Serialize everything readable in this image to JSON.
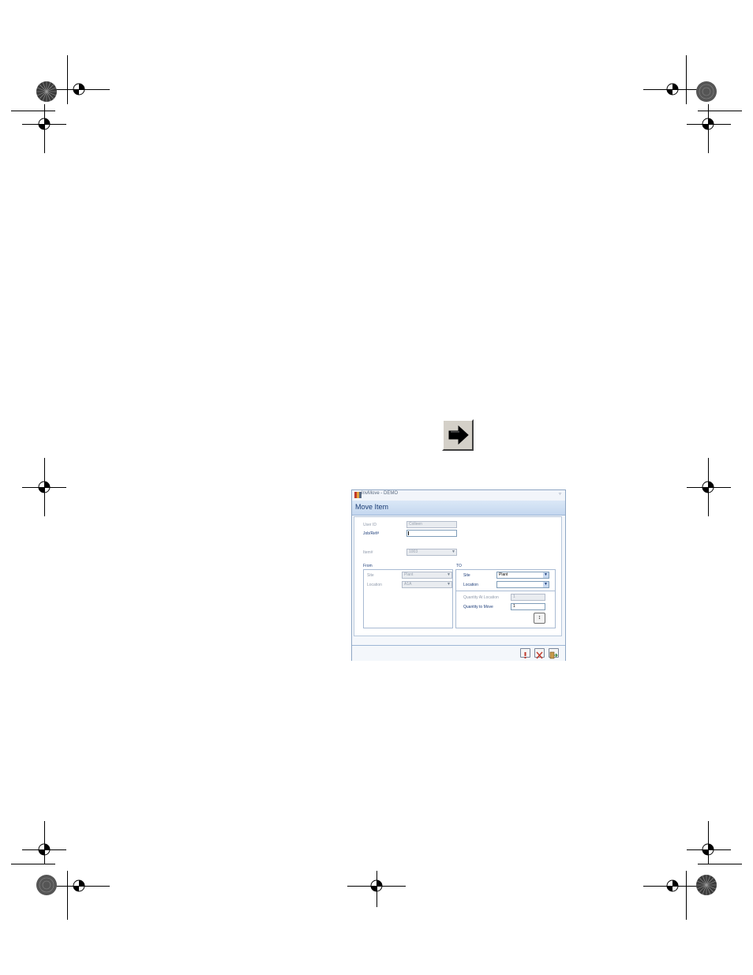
{
  "window": {
    "title": "InvMove - DEMO",
    "menu_glyph": "▿",
    "form_title": "Move Item"
  },
  "form": {
    "user_id_label": "User ID",
    "user_id_value": "Colleen",
    "job_ref_label": "Job/Ref#",
    "job_ref_value": "",
    "item_label": "Item#",
    "item_value": "1003",
    "from_label": "From",
    "to_label": "TO",
    "from_site_label": "Site",
    "from_site_value": "Plant",
    "from_location_label": "Location",
    "from_location_value": "A1A",
    "to_site_label": "Site",
    "to_site_value": "Plant",
    "to_location_label": "Location",
    "to_location_value": "",
    "qty_at_location_label": "Quantity At Location",
    "qty_at_location_value": "1",
    "qty_to_move_label": "Quantity to Move",
    "qty_to_move_value": "1",
    "move_button_glyph": "↕"
  },
  "toolbar": {
    "save_icon": "exclamation-icon",
    "cancel_icon": "x-icon",
    "exit_icon": "exit-door-icon"
  },
  "colors": {
    "header": "#c4d7ef",
    "title_text": "#1b3d75",
    "arrow_button": "#d4d0c8"
  }
}
